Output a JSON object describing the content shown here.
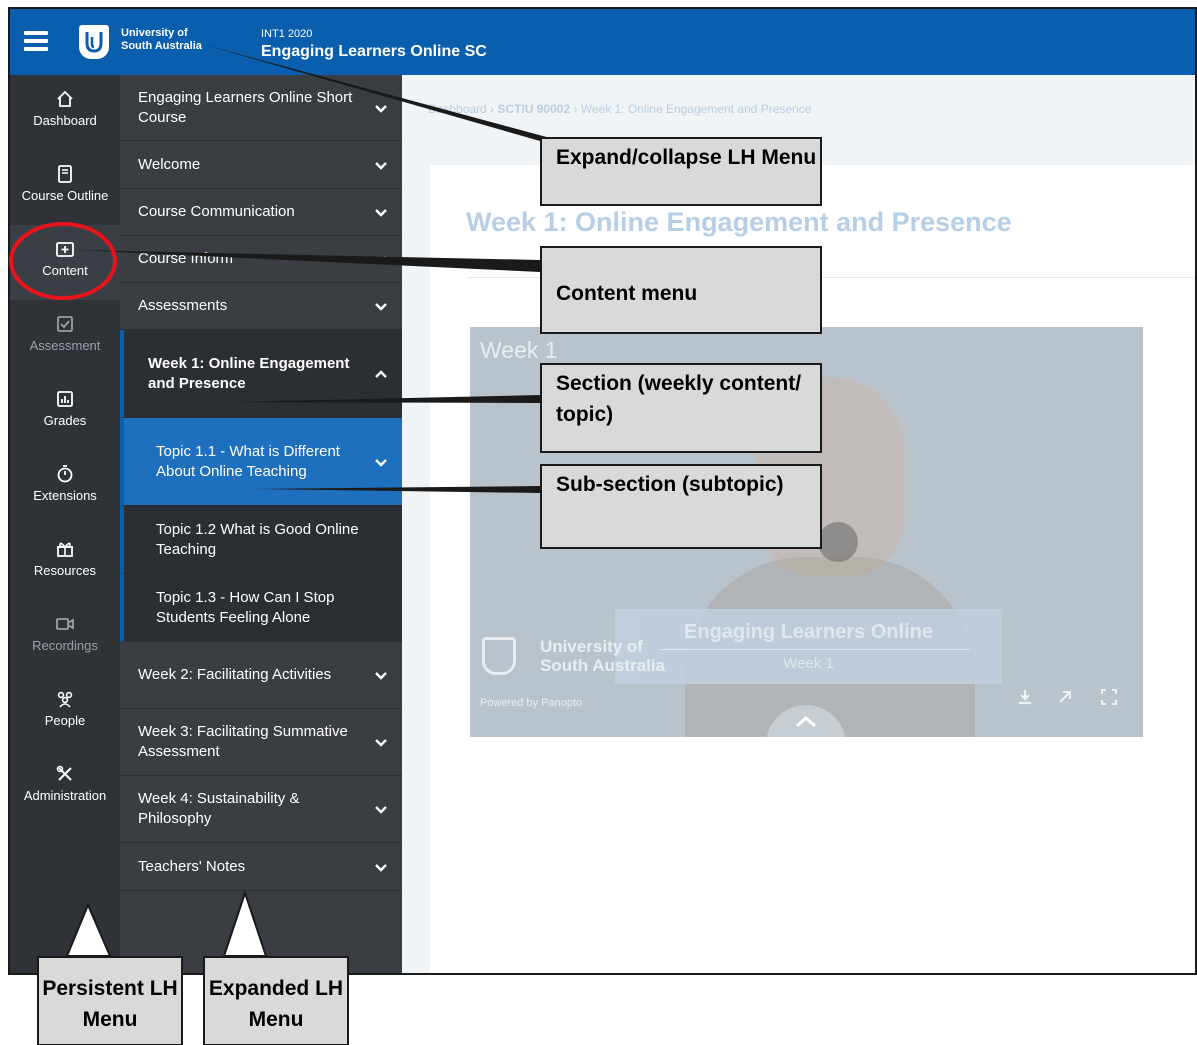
{
  "topbar": {
    "university": "University of South Australia",
    "course_code": "INT1 2020",
    "course_title": "Engaging Learners Online SC"
  },
  "persistent_menu": [
    {
      "label": "Dashboard",
      "icon": "home-icon",
      "dim": false
    },
    {
      "label": "Course Outline",
      "icon": "book-icon",
      "dim": false
    },
    {
      "label": "Content",
      "icon": "content-folder-icon",
      "dim": false,
      "active": true
    },
    {
      "label": "Assessment",
      "icon": "checkbox-icon",
      "dim": true
    },
    {
      "label": "Grades",
      "icon": "bar-chart-icon",
      "dim": false
    },
    {
      "label": "Extensions",
      "icon": "stopwatch-icon",
      "dim": false
    },
    {
      "label": "Resources",
      "icon": "gift-icon",
      "dim": false
    },
    {
      "label": "Recordings",
      "icon": "video-camera-icon",
      "dim": true
    },
    {
      "label": "People",
      "icon": "people-icon",
      "dim": false
    },
    {
      "label": "Administration",
      "icon": "tools-icon",
      "dim": false
    }
  ],
  "expanded_menu": [
    {
      "label": "Engaging Learners Online Short Course",
      "kind": "top",
      "chevron": "down"
    },
    {
      "label": "Welcome",
      "kind": "top",
      "chevron": "down"
    },
    {
      "label": "Course Communication",
      "kind": "top",
      "chevron": "down"
    },
    {
      "label": "Course Inform",
      "kind": "top",
      "chevron": "down"
    },
    {
      "label": "Assessments",
      "kind": "top",
      "chevron": "down"
    },
    {
      "label": "Week 1: Online Engagement and Presence",
      "kind": "section",
      "chevron": "up"
    },
    {
      "label": "Topic 1.1 - What is Different About Online Teaching",
      "kind": "subactive",
      "chevron": "down"
    },
    {
      "label": "Topic 1.2 What is Good Online Teaching",
      "kind": "sub",
      "chevron": "none"
    },
    {
      "label": "Topic 1.3 - How Can I Stop Students Feeling Alone",
      "kind": "sub",
      "chevron": "none"
    },
    {
      "label": "Week 2: Facilitating Activities",
      "kind": "top",
      "chevron": "down"
    },
    {
      "label": "Week 3: Facilitating Summative Assessment",
      "kind": "top",
      "chevron": "down"
    },
    {
      "label": "Week 4: Sustainability & Philosophy",
      "kind": "top",
      "chevron": "down"
    },
    {
      "label": "Teachers' Notes",
      "kind": "top",
      "chevron": "down"
    }
  ],
  "breadcrumb": {
    "home": "Dashboard",
    "course": "SCTIU 90002",
    "page": "Week 1: Online Engagement and Presence"
  },
  "page_title": "Week 1: Online Engagement and Presence",
  "video": {
    "corner_label": "Week 1",
    "banner_title": "Engaging Learners Online",
    "banner_subtitle": "Week 1",
    "university": "University of South Australia",
    "powered_by": "Powered by Panopto"
  },
  "annotations": {
    "expand_collapse": "Expand/collapse LH Menu",
    "content_menu": "Content menu",
    "section": "Section (weekly content/ topic)",
    "subsection": "Sub-section (subtopic)",
    "persistent": "Persistent LH Menu",
    "expanded": "Expanded LH Menu",
    "highlight_color": "#e8141b"
  }
}
